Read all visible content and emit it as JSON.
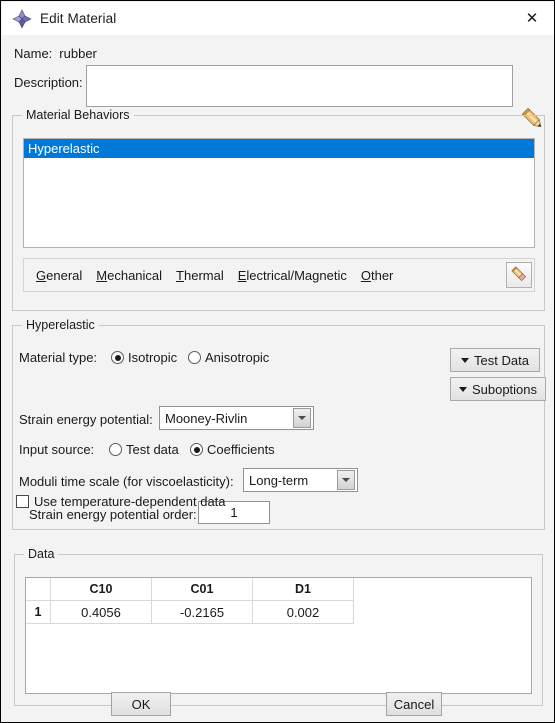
{
  "window": {
    "title": "Edit Material",
    "icon": "abaqus-diamond-icon",
    "close_label": "✕"
  },
  "header": {
    "name_label": "Name:",
    "name_value": "rubber",
    "description_label": "Description:",
    "description_value": "",
    "description_placeholder": "",
    "edit_pencil_icon": "pencil-icon"
  },
  "behaviors": {
    "group_label": "Material Behaviors",
    "items": [
      {
        "label": "Hyperelastic",
        "selected": true
      }
    ],
    "tabs": [
      {
        "mnemonic": "G",
        "rest": "eneral"
      },
      {
        "mnemonic": "M",
        "rest": "echanical"
      },
      {
        "mnemonic": "T",
        "rest": "hermal"
      },
      {
        "mnemonic": "E",
        "rest": "lectrical/Magnetic"
      },
      {
        "mnemonic": "O",
        "rest": "ther"
      }
    ],
    "tab_pencil_icon": "eraser-pencil-icon"
  },
  "hyperelastic": {
    "group_label": "Hyperelastic",
    "material_type_label": "Material type:",
    "material_type_options": [
      {
        "label": "Isotropic",
        "selected": true
      },
      {
        "label": "Anisotropic",
        "selected": false
      }
    ],
    "test_data_button": "Test Data",
    "suboptions_button": "Suboptions",
    "strain_energy_label": "Strain energy potential:",
    "strain_energy_value": "Mooney-Rivlin",
    "input_source_label": "Input source:",
    "input_source_options": [
      {
        "label": "Test data",
        "selected": false
      },
      {
        "label": "Coefficients",
        "selected": true
      }
    ],
    "moduli_label": "Moduli time scale (for viscoelasticity):",
    "moduli_value": "Long-term",
    "order_label": "Strain energy potential order:",
    "order_value": "1",
    "temp_dependent_label": "Use temperature-dependent data",
    "temp_dependent_checked": false
  },
  "data_table": {
    "group_label": "Data",
    "columns": [
      "C10",
      "C01",
      "D1"
    ],
    "rows": [
      {
        "index": "1",
        "values": [
          "0.4056",
          "-0.2165",
          "0.002"
        ]
      }
    ]
  },
  "footer": {
    "ok_label": "OK",
    "cancel_label": "Cancel"
  },
  "colors": {
    "selection_blue": "#0078d7",
    "window_bg": "#f3f3f3",
    "titlebar_bg": "#ffffff",
    "field_bg": "#ffffff"
  }
}
